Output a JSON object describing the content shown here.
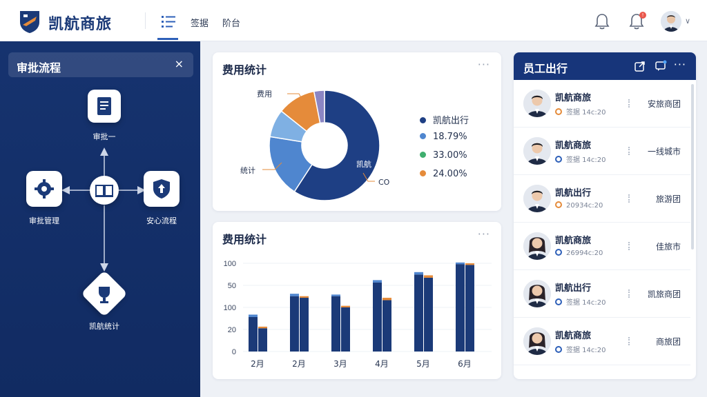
{
  "app": {
    "brand": "凯航商旅",
    "nav": [
      "签据",
      "阶台"
    ]
  },
  "left_panel": {
    "title": "审批流程",
    "close": "×",
    "nodes": [
      {
        "label": "审批一",
        "icon": "document-icon"
      },
      {
        "label": "审批管理",
        "icon": "gear-icon"
      },
      {
        "label": "",
        "icon": "book-icon"
      },
      {
        "label": "安心流程",
        "icon": "shield-arrow-icon"
      },
      {
        "label": "凯航统计",
        "icon": "trophy-icon"
      }
    ]
  },
  "pie_card": {
    "title": "费用统计",
    "more": "···",
    "labels": [
      "费用",
      "统计",
      "凯航",
      "CO"
    ],
    "legend": [
      {
        "label": "凯航出行",
        "color": "#1e3f84"
      },
      {
        "label": "18.79%",
        "color": "#4f86cf"
      },
      {
        "label": "33.00%",
        "color": "#3fae6e"
      },
      {
        "label": "24.00%",
        "color": "#e58b3a"
      }
    ]
  },
  "bar_card": {
    "title": "费用统计",
    "more": "···"
  },
  "chart_data": [
    {
      "type": "pie",
      "donut": true,
      "slices": [
        {
          "label": "凯航",
          "value": 58,
          "color": "#1e3f84"
        },
        {
          "label": "统计",
          "value": 18,
          "color": "#4f86cf"
        },
        {
          "label": "",
          "value": 8,
          "color": "#7fb0e3"
        },
        {
          "label": "费用",
          "value": 11,
          "color": "#e58b3a"
        },
        {
          "label": "",
          "value": 3,
          "color": "#8b86c4"
        }
      ]
    },
    {
      "type": "bar",
      "categories": [
        "2月",
        "2月",
        "3月",
        "4月",
        "5月",
        "6月"
      ],
      "yticks": [
        "0",
        "20",
        "100",
        "50",
        "100"
      ],
      "ylim": [
        0,
        100
      ],
      "series": [
        {
          "values": [
            43,
            69,
            69,
            86,
            96,
            109
          ],
          "color": "#1b3a78"
        },
        {
          "values": [
            29,
            67,
            55,
            64,
            92,
            108
          ],
          "color": "#1b3a78"
        }
      ],
      "caps": {
        "series_1": {
          "color": "#4f86cf",
          "values": [
            3,
            3,
            2,
            3,
            3,
            2
          ]
        },
        "series_2": {
          "color": "#e58b3a",
          "values": [
            2,
            2,
            2,
            3,
            3,
            2
          ]
        }
      }
    }
  ],
  "right_panel": {
    "title": "员工出行",
    "more": "···",
    "employees": [
      {
        "name": "凯航商旅",
        "status": "签据 14c:20",
        "status_color": "#e58b3a",
        "dept": "安旅商团"
      },
      {
        "name": "凯航商旅",
        "status": "签据 14c:20",
        "status_color": "#2d5fb8",
        "dept": "一线城市"
      },
      {
        "name": "凯航出行",
        "status": "20934c:20",
        "status_color": "#e58b3a",
        "dept": "旅游团"
      },
      {
        "name": "凯航商旅",
        "status": "26994c:20",
        "status_color": "#2d5fb8",
        "dept": "佳旅市"
      },
      {
        "name": "凯航出行",
        "status": "签据 14c:20",
        "status_color": "#2d5fb8",
        "dept": "凯旅商团"
      },
      {
        "name": "凯航商旅",
        "status": "签据 14c:20",
        "status_color": "#2d5fb8",
        "dept": "商旅团"
      }
    ]
  }
}
